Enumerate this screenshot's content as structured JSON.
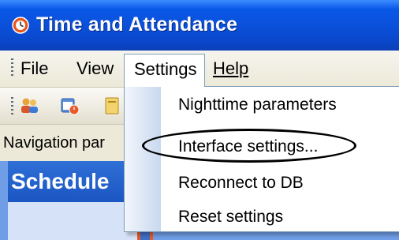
{
  "window": {
    "title": "Time and Attendance",
    "title_bar_color": "#0a4fd8",
    "app_icon": "clock-icon"
  },
  "menubar": {
    "items": [
      {
        "label": "File"
      },
      {
        "label": "View"
      },
      {
        "label": "Settings"
      },
      {
        "label": "Help"
      }
    ],
    "active": "Settings"
  },
  "toolbar": {
    "icons": [
      "users-icon",
      "schedule-clock-icon",
      "document-icon"
    ]
  },
  "navigation": {
    "header": "Navigation par",
    "panel_title": "Schedule"
  },
  "dropdown": {
    "items": [
      {
        "label": "Nighttime parameters"
      },
      {
        "label": "Interface settings..."
      },
      {
        "label": "Reconnect to DB"
      },
      {
        "label": "Reset settings"
      }
    ],
    "highlighted": "Interface settings..."
  }
}
